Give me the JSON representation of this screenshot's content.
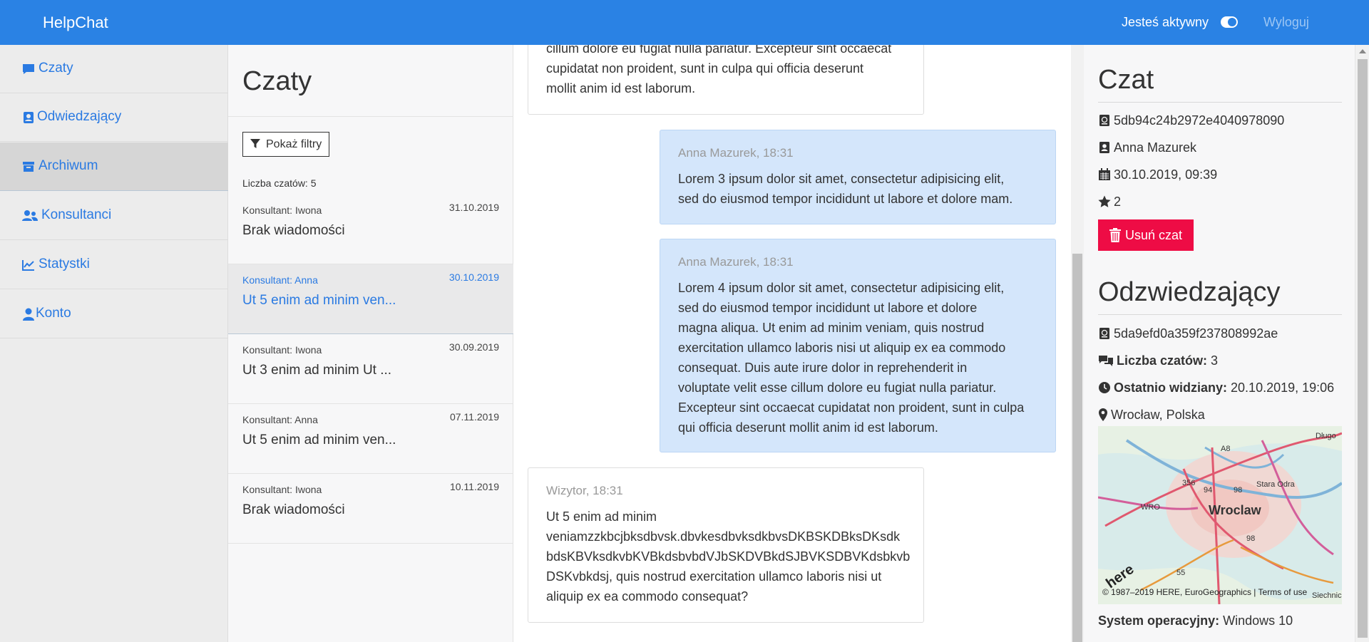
{
  "navbar": {
    "brand": "HelpChat",
    "status_label": "Jesteś aktywny",
    "logout_label": "Wyloguj"
  },
  "sidebar": {
    "items": [
      {
        "label": "Czaty",
        "icon": "chat-icon"
      },
      {
        "label": "Odwiedzający",
        "icon": "address-card-icon"
      },
      {
        "label": "Archiwum",
        "icon": "archive-icon",
        "active": true
      },
      {
        "label": "Konsultanci",
        "icon": "users-icon"
      },
      {
        "label": "Statystki",
        "icon": "chart-line-icon"
      },
      {
        "label": "Konto",
        "icon": "user-icon"
      }
    ]
  },
  "chatlist": {
    "title": "Czaty",
    "filter_label": "Pokaż filtry",
    "count_label": "Liczba czatów: 5",
    "items": [
      {
        "consultant": "Konsultant: Iwona",
        "date": "31.10.2019",
        "preview": "Brak wiadomości"
      },
      {
        "consultant": "Konsultant: Anna",
        "date": "30.10.2019",
        "preview": "Ut 5 enim ad minim ven...",
        "selected": true
      },
      {
        "consultant": "Konsultant: Iwona",
        "date": "30.09.2019",
        "preview": "Ut 3 enim ad minim Ut ..."
      },
      {
        "consultant": "Konsultant: Anna",
        "date": "07.11.2019",
        "preview": "Ut 5 enim ad minim ven..."
      },
      {
        "consultant": "Konsultant: Iwona",
        "date": "10.11.2019",
        "preview": "Brak wiadomości"
      }
    ]
  },
  "messages": [
    {
      "type": "visitor",
      "meta": "",
      "lines": [
        "cillum dolore eu fugiat nulla pariatur. Excepteur sint occaecat",
        "cupidatat non proident, sunt in culpa qui officia deserunt",
        "mollit anim id est laborum."
      ]
    },
    {
      "type": "agent",
      "meta": "Anna Mazurek, 18:31",
      "lines": [
        "Lorem 3 ipsum dolor sit amet, consectetur adipisicing elit,",
        "sed do eiusmod tempor incididunt ut labore et dolore mam."
      ]
    },
    {
      "type": "agent",
      "meta": "Anna Mazurek, 18:31",
      "lines": [
        "Lorem 4 ipsum dolor sit amet, consectetur adipisicing elit,",
        "sed do eiusmod tempor incididunt ut labore et dolore",
        "magna aliqua. Ut enim ad minim veniam, quis nostrud",
        "exercitation ullamco laboris nisi ut aliquip ex ea commodo",
        "consequat. Duis aute irure dolor in reprehenderit in",
        "voluptate velit esse cillum dolore eu fugiat nulla pariatur.",
        "Excepteur sint occaecat cupidatat non proident, sunt in culpa",
        "qui officia deserunt mollit anim id est laborum."
      ]
    },
    {
      "type": "visitor",
      "meta": "Wizytor, 18:31",
      "lines": [
        "Ut 5 enim ad minim",
        "veniamzzkbcjbksdbvsk.dbvkesdbvksdkbvsDKBSKDBksDKsdk",
        "bdsKBVksdkvbKVBkdsbvbdVJbSKDVBkdSJBVKSDBVKdsbkvb",
        "DSKvbkdsj, quis nostrud exercitation ullamco laboris nisi ut",
        "aliquip ex ea commodo consequat?"
      ]
    }
  ],
  "chat_details": {
    "title": "Czat",
    "id": "5db94c24b2972e4040978090",
    "agent": "Anna Mazurek",
    "date": "30.10.2019, 09:39",
    "rating": "2",
    "delete_label": "Usuń czat"
  },
  "visitor_details": {
    "title": "Odzwiedzający",
    "id": "5da9efd0a359f237808992ae",
    "chat_count_label": "Liczba czatów:",
    "chat_count": "3",
    "last_seen_label": "Ostatnio widziany:",
    "last_seen": "20.10.2019, 19:06",
    "location": "Wrocław, Polska",
    "os_label": "System operacyjny:",
    "os": "Windows 10"
  },
  "map": {
    "city": "Wroclaw",
    "caption": "© 1987–2019 HERE, EuroGeographics | Terms of use",
    "brand": "here",
    "labels": [
      "Długo",
      "Stara Odra",
      "WRO",
      "Siechnice",
      "A8",
      "356",
      "94",
      "98",
      "98",
      "55"
    ]
  },
  "colors": {
    "accent": "#2a82e4",
    "agent_bubble": "#d4e6fb",
    "danger": "#ee0c45",
    "link": "#2a7ae2"
  }
}
